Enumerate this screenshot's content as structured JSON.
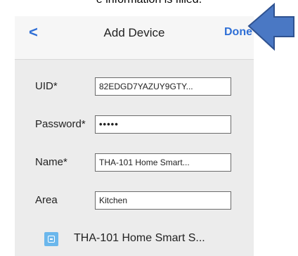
{
  "caption": "e information is filled.",
  "navbar": {
    "back_label": "<",
    "title": "Add Device",
    "done_label": "Done"
  },
  "form": {
    "uid_label": "UID*",
    "uid_value": "82EDGD7YAZUY9GTY...",
    "password_label": "Password*",
    "password_value": "•••••",
    "name_label": "Name*",
    "name_value": "THA-101 Home Smart...",
    "area_label": "Area",
    "area_value": "Kitchen"
  },
  "device": {
    "icon": "smart-plug-icon",
    "label": "THA-101 Home Smart S..."
  },
  "annotation": {
    "icon": "arrow-left-icon",
    "color": "#4a78c4"
  }
}
